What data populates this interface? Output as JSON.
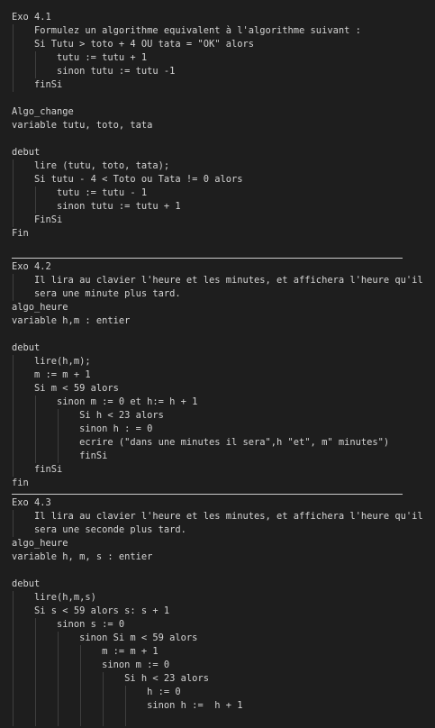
{
  "document": {
    "lines": [
      {
        "text": "Exo 4.1",
        "indent": 0
      },
      {
        "text": "Formulez un algorithme equivalent à l'algorithme suivant :",
        "indent": 1
      },
      {
        "text": "Si Tutu > toto + 4 OU tata = \"OK\" alors",
        "indent": 1
      },
      {
        "text": "tutu := tutu + 1",
        "indent": 2
      },
      {
        "text": "sinon tutu := tutu -1",
        "indent": 2
      },
      {
        "text": "finSi",
        "indent": 1
      },
      {
        "text": "",
        "indent": 0
      },
      {
        "text": "Algo_change",
        "indent": 0
      },
      {
        "text": "variable tutu, toto, tata",
        "indent": 0
      },
      {
        "text": "",
        "indent": 0
      },
      {
        "text": "debut",
        "indent": 0
      },
      {
        "text": "lire (tutu, toto, tata);",
        "indent": 1
      },
      {
        "text": "Si tutu - 4 < Toto ou Tata != 0 alors",
        "indent": 1
      },
      {
        "text": "tutu := tutu - 1",
        "indent": 2
      },
      {
        "text": "sinon tutu := tutu + 1",
        "indent": 2
      },
      {
        "text": "FinSi",
        "indent": 1
      },
      {
        "text": "Fin",
        "indent": 0
      },
      {
        "text": "",
        "indent": 0
      },
      {
        "sep": true
      },
      {
        "text": "Exo 4.2",
        "indent": 0
      },
      {
        "text": "Il lira au clavier l'heure et les minutes, et affichera l'heure qu'il",
        "indent": 1
      },
      {
        "text": "sera une minute plus tard.",
        "indent": 1
      },
      {
        "text": "algo_heure",
        "indent": 0
      },
      {
        "text": "variable h,m : entier",
        "indent": 0
      },
      {
        "text": "",
        "indent": 0
      },
      {
        "text": "debut",
        "indent": 0
      },
      {
        "text": "lire(h,m);",
        "indent": 1
      },
      {
        "text": "m := m + 1",
        "indent": 1
      },
      {
        "text": "Si m < 59 alors",
        "indent": 1
      },
      {
        "text": "sinon m := 0 et h:= h + 1",
        "indent": 2
      },
      {
        "text": "Si h < 23 alors",
        "indent": 3
      },
      {
        "text": "sinon h : = 0",
        "indent": 3
      },
      {
        "text": "ecrire (\"dans une minutes il sera\",h \"et\", m\" minutes\")",
        "indent": 3
      },
      {
        "text": "finSi",
        "indent": 3
      },
      {
        "text": "finSi",
        "indent": 1
      },
      {
        "text": "fin",
        "indent": 0
      },
      {
        "sep": true
      },
      {
        "text": "Exo 4.3",
        "indent": 0
      },
      {
        "text": "Il lira au clavier l'heure et les minutes, et affichera l'heure qu'il",
        "indent": 1
      },
      {
        "text": "sera une seconde plus tard.",
        "indent": 1
      },
      {
        "text": "algo_heure",
        "indent": 0
      },
      {
        "text": "variable h, m, s : entier",
        "indent": 0
      },
      {
        "text": "",
        "indent": 0
      },
      {
        "text": "debut",
        "indent": 0
      },
      {
        "text": "lire(h,m,s)",
        "indent": 1
      },
      {
        "text": "Si s < 59 alors s: s + 1",
        "indent": 1
      },
      {
        "text": "sinon s := 0",
        "indent": 2
      },
      {
        "text": "sinon Si m < 59 alors",
        "indent": 3
      },
      {
        "text": "m := m + 1",
        "indent": 4
      },
      {
        "text": "sinon m := 0",
        "indent": 4
      },
      {
        "text": "Si h < 23 alors",
        "indent": 5
      },
      {
        "text": "h := 0",
        "indent": 6
      },
      {
        "text": "sinon h :=  h + 1",
        "indent": 6
      },
      {
        "text": "",
        "indent": 6
      }
    ]
  }
}
